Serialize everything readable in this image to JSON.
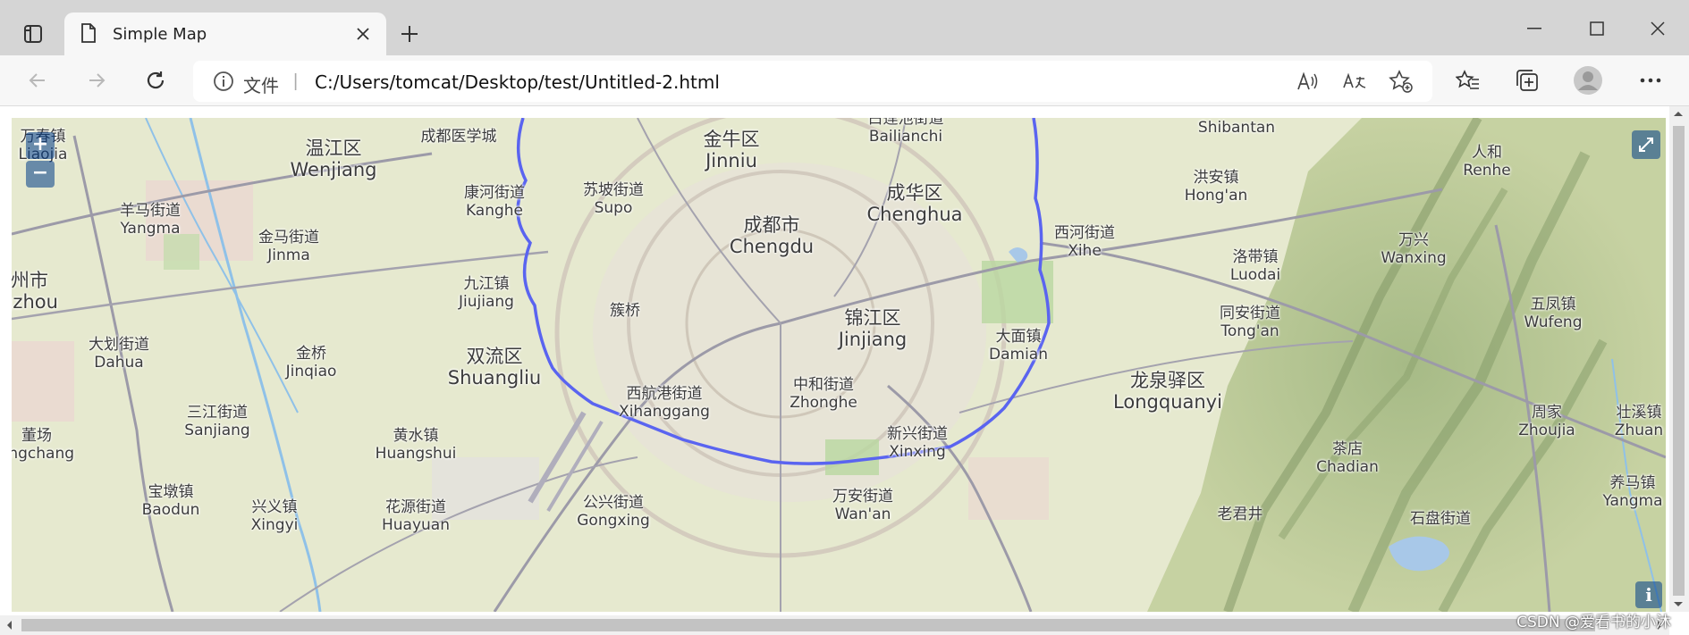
{
  "window": {
    "tab_title": "Simple Map",
    "icons": {
      "tab_actions": "tab-actions-icon",
      "page": "page-icon",
      "close": "close-icon",
      "new_tab": "plus-icon",
      "minimize": "minimize-icon",
      "maximize": "maximize-icon",
      "close_window": "close-window-icon"
    }
  },
  "toolbar": {
    "address_prefix": "文件",
    "address_separator": "|",
    "url": "C:/Users/tomcat/Desktop/test/Untitled-2.html",
    "icons": [
      "back-icon",
      "forward-icon",
      "refresh-icon",
      "info-icon",
      "read-aloud-icon",
      "translate-icon",
      "add-favorite-icon",
      "favorites-icon",
      "collections-icon",
      "profile-icon",
      "more-icon"
    ]
  },
  "map": {
    "zoom_in": "+",
    "zoom_out": "−",
    "info": "i",
    "route_color": "#5a64f0",
    "labels": [
      {
        "zh": "温江区",
        "en": "Wenjiang",
        "size": "big"
      },
      {
        "zh": "成都医学城",
        "en": "",
        "size": "small"
      },
      {
        "zh": "金牛区",
        "en": "Jinniu",
        "size": "big"
      },
      {
        "zh": "白莲池街道",
        "en": "Bailianchi",
        "size": "small"
      },
      {
        "zh": "",
        "en": "Shibantan",
        "size": "small"
      },
      {
        "zh": "人和",
        "en": "Renhe",
        "size": "small"
      },
      {
        "zh": "康河街道",
        "en": "Kanghe",
        "size": "small"
      },
      {
        "zh": "苏坡街道",
        "en": "Supo",
        "size": "small"
      },
      {
        "zh": "成都市",
        "en": "Chengdu",
        "size": "big"
      },
      {
        "zh": "成华区",
        "en": "Chenghua",
        "size": "big"
      },
      {
        "zh": "洪安镇",
        "en": "Hong'an",
        "size": "small"
      },
      {
        "zh": "羊马街道",
        "en": "Yangma",
        "size": "small"
      },
      {
        "zh": "金马街道",
        "en": "Jinma",
        "size": "small"
      },
      {
        "zh": "西河街道",
        "en": "Xihe",
        "size": "small"
      },
      {
        "zh": "万兴",
        "en": "Wanxing",
        "size": "small"
      },
      {
        "zh": "洛带镇",
        "en": "Luodai",
        "size": "small"
      },
      {
        "zh": "九江镇",
        "en": "Jiujiang",
        "size": "small"
      },
      {
        "zh": "簇桥",
        "en": "",
        "size": "small"
      },
      {
        "zh": "锦江区",
        "en": "Jinjiang",
        "size": "big"
      },
      {
        "zh": "同安街道",
        "en": "Tong'an",
        "size": "small"
      },
      {
        "zh": "五凤镇",
        "en": "Wufeng",
        "size": "small"
      },
      {
        "zh": "大划街道",
        "en": "Dahua",
        "size": "small"
      },
      {
        "zh": "金桥",
        "en": "Jinqiao",
        "size": "small"
      },
      {
        "zh": "双流区",
        "en": "Shuangliu",
        "size": "big"
      },
      {
        "zh": "大面镇",
        "en": "Damian",
        "size": "small"
      },
      {
        "zh": "西航港街道",
        "en": "Xihanggang",
        "size": "small"
      },
      {
        "zh": "中和街道",
        "en": "Zhonghe",
        "size": "small"
      },
      {
        "zh": "龙泉驿区",
        "en": "Longquanyi",
        "size": "big"
      },
      {
        "zh": "三江街道",
        "en": "Sanjiang",
        "size": "small"
      },
      {
        "zh": "周家",
        "en": "Zhoujia",
        "size": "small"
      },
      {
        "zh": "壮溪镇",
        "en": "Zhuan",
        "size": "small"
      },
      {
        "zh": "董场",
        "en": "ongchang",
        "size": "small"
      },
      {
        "zh": "黄水镇",
        "en": "Huangshui",
        "size": "small"
      },
      {
        "zh": "新兴街道",
        "en": "Xinxing",
        "size": "small"
      },
      {
        "zh": "茶店",
        "en": "Chadian",
        "size": "small"
      },
      {
        "zh": "宝墩镇",
        "en": "Baodun",
        "size": "small"
      },
      {
        "zh": "兴义镇",
        "en": "Xingyi",
        "size": "small"
      },
      {
        "zh": "花源街道",
        "en": "Huayuan",
        "size": "small"
      },
      {
        "zh": "公兴街道",
        "en": "Gongxing",
        "size": "small"
      },
      {
        "zh": "万安街道",
        "en": "Wan'an",
        "size": "small"
      },
      {
        "zh": "老君井",
        "en": "",
        "size": "small"
      },
      {
        "zh": "石盘街道",
        "en": "",
        "size": "small"
      },
      {
        "zh": "养马镇",
        "en": "Yangma",
        "size": "small"
      },
      {
        "zh": "州市",
        "en": "gzhou",
        "size": "big"
      },
      {
        "zh": "万春镇",
        "en": "Liaojia",
        "size": "small"
      }
    ]
  },
  "watermark": "CSDN @爱看书的小沐"
}
